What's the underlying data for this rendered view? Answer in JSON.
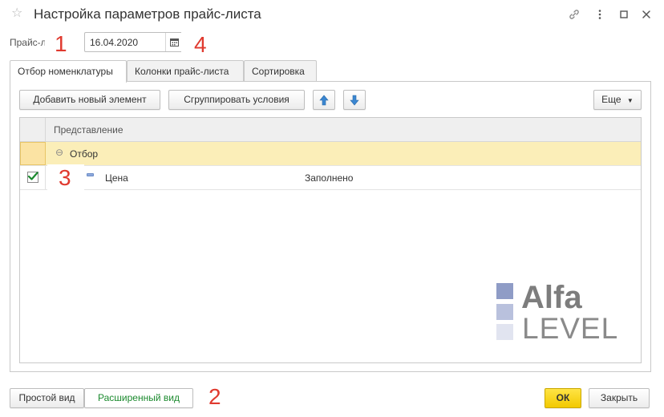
{
  "window": {
    "title": "Настройка параметров прайс-листа"
  },
  "date": {
    "label": "Прайс-лист на",
    "value": "16.04.2020"
  },
  "tabs": [
    {
      "label": "Отбор номенклатуры",
      "active": true
    },
    {
      "label": "Колонки прайс-листа",
      "active": false
    },
    {
      "label": "Сортировка",
      "active": false
    }
  ],
  "toolbar": {
    "add_label": "Добавить новый элемент",
    "group_label": "Сгруппировать условия",
    "more_label": "Еще"
  },
  "grid": {
    "column_header": "Представление",
    "rows": [
      {
        "label": "Отбор",
        "value": "",
        "checked": false
      },
      {
        "label": "Цена",
        "value": "Заполнено",
        "checked": true
      }
    ]
  },
  "annotations": [
    "1",
    "2",
    "3",
    "4"
  ],
  "logo": {
    "line1": "Alfa",
    "line2": "LEVEL",
    "colors": [
      "#8f9cc6",
      "#b9c1dd",
      "#e1e4f0"
    ]
  },
  "bottom": {
    "simple_view": "Простой вид",
    "extended_view": "Расширенный вид",
    "ok": "ОК",
    "close": "Закрыть"
  },
  "colors": {
    "group_row": "#fbeeb8",
    "ok_button": "#f2c900",
    "accent_green": "#1b8a2e",
    "arrow_blue": "#3a86d1",
    "annotation_red": "#e03a2f"
  }
}
